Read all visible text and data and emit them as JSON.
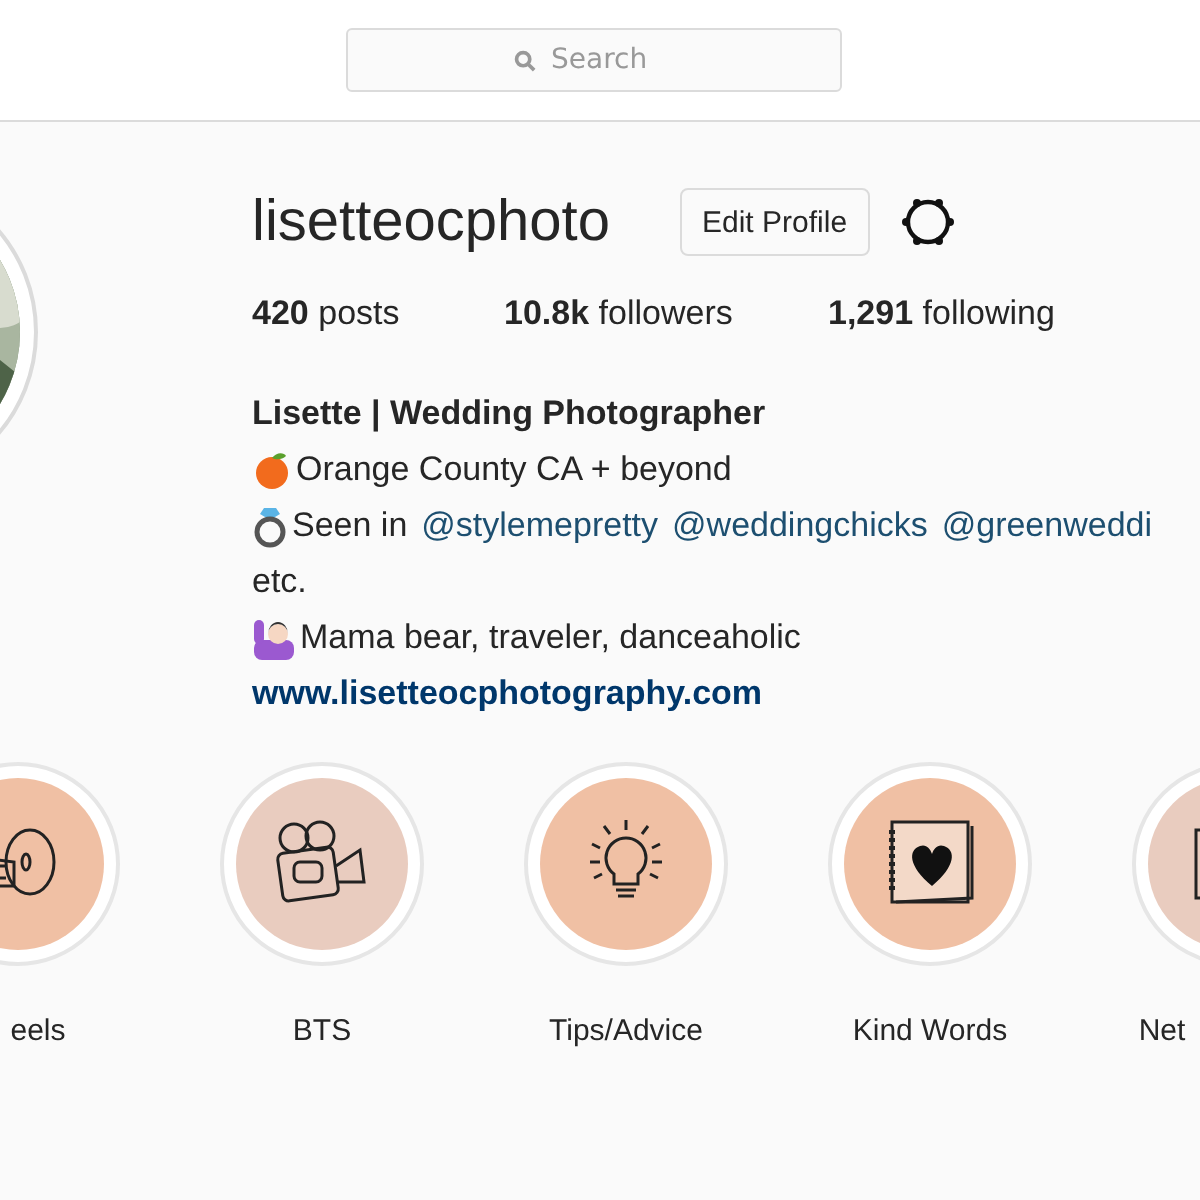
{
  "search": {
    "placeholder": "Search"
  },
  "profile": {
    "username": "lisetteocphoto",
    "edit_button": "Edit Profile",
    "stats": [
      {
        "count": "420",
        "label": "posts"
      },
      {
        "count": "10.8k",
        "label": "followers"
      },
      {
        "count": "1,291",
        "label": "following"
      }
    ],
    "bio": {
      "name": "Lisette | Wedding Photographer",
      "lines": [
        {
          "kind": "orange",
          "parts": [
            {
              "kind": "text",
              "text": "Orange County CA + beyond"
            }
          ]
        },
        {
          "kind": "ring",
          "parts": [
            {
              "kind": "text",
              "text": "Seen in"
            },
            {
              "kind": "mention",
              "text": "@stylemepretty"
            },
            {
              "kind": "mention",
              "text": "@weddingchicks"
            },
            {
              "kind": "mention",
              "text": "@greenweddi"
            }
          ]
        },
        {
          "kind": "plain",
          "parts": [
            {
              "kind": "text",
              "text": "etc."
            }
          ]
        },
        {
          "kind": "person",
          "parts": [
            {
              "kind": "text",
              "text": "Mama bear, traveler, danceaholic"
            }
          ]
        }
      ],
      "website": "www.lisetteocphotography.com"
    }
  },
  "highlights": [
    {
      "label": "eels",
      "kind": "film",
      "color": "#f0c0a4"
    },
    {
      "label": "BTS",
      "kind": "camera",
      "color": "#e9ccbf"
    },
    {
      "label": "Tips/Advice",
      "kind": "bulb",
      "color": "#f0c0a4"
    },
    {
      "label": "Kind Words",
      "kind": "notebook",
      "color": "#f0c0a4"
    },
    {
      "label": "Net",
      "kind": "frame",
      "color": "#e9ccbf"
    }
  ]
}
